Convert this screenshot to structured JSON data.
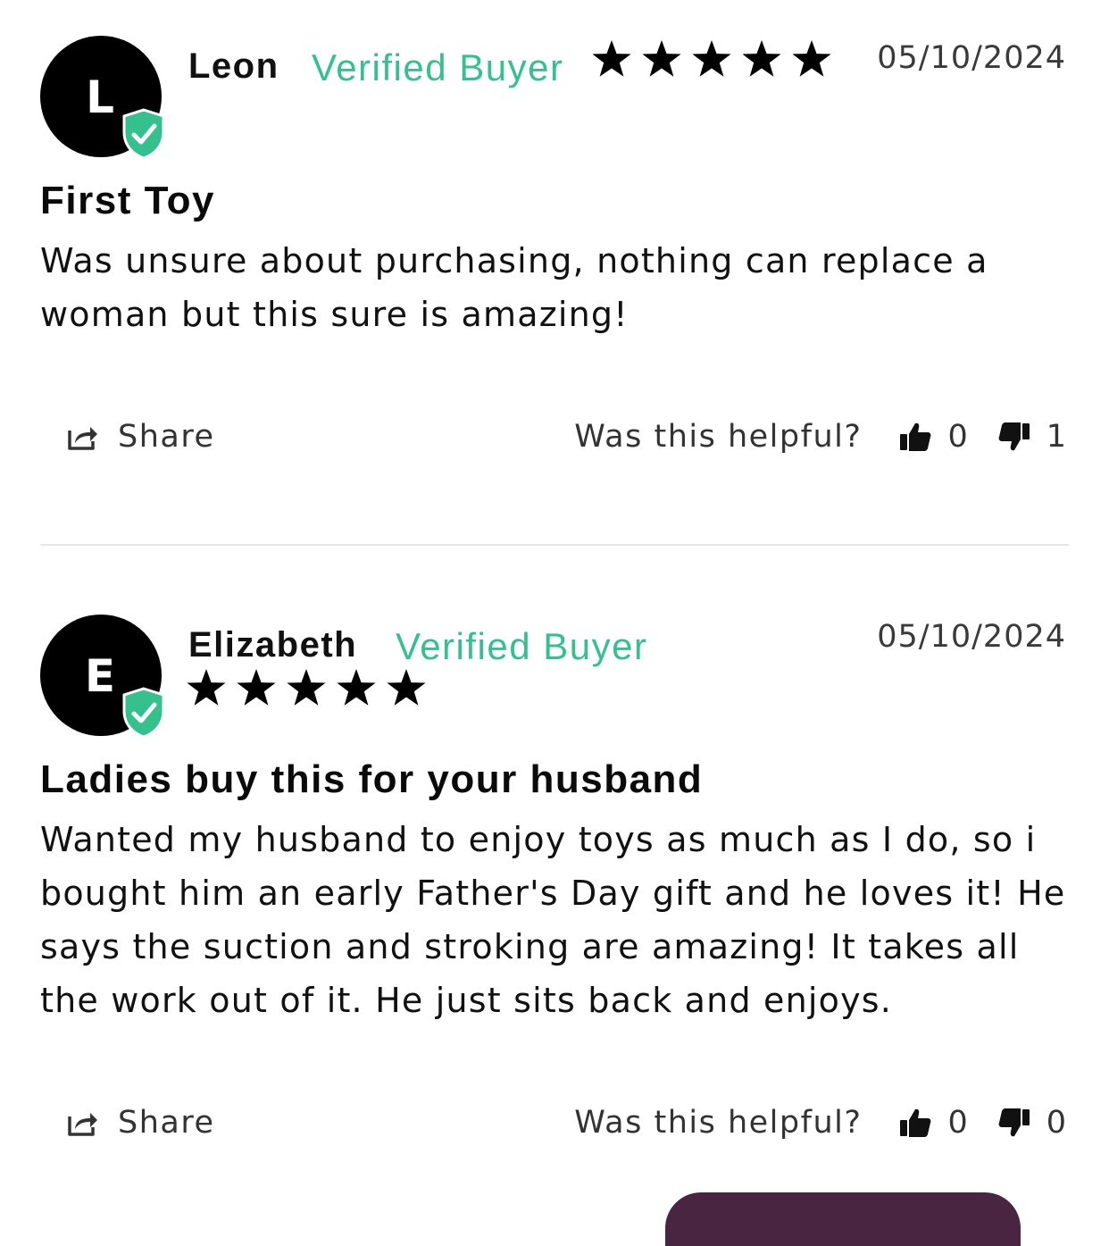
{
  "reviews": [
    {
      "avatar_letter": "L",
      "name": "Leon",
      "verified_label": "Verified Buyer",
      "rating": 5,
      "date": "05/10/2024",
      "title": "First Toy",
      "body": "Was unsure about purchasing, nothing can replace a woman but this sure is amazing!",
      "share_label": "Share",
      "helpful_label": "Was this helpful?",
      "thumbs_up_count": "0",
      "thumbs_down_count": "1"
    },
    {
      "avatar_letter": "E",
      "name": "Elizabeth",
      "verified_label": "Verified Buyer",
      "rating": 5,
      "date": "05/10/2024",
      "title": "Ladies buy this for your husband",
      "body": "Wanted my husband to enjoy toys as much as I do, so i bought him an early Father's Day gift and he loves it! He says the suction and stroking are amazing! It takes all the work out of it. He just sits back and enjoys.",
      "share_label": "Share",
      "helpful_label": "Was this helpful?",
      "thumbs_up_count": "0",
      "thumbs_down_count": "0"
    }
  ],
  "colors": {
    "verified": "#35c08f",
    "badge": "#35c08f",
    "cta": "#4a2542"
  }
}
